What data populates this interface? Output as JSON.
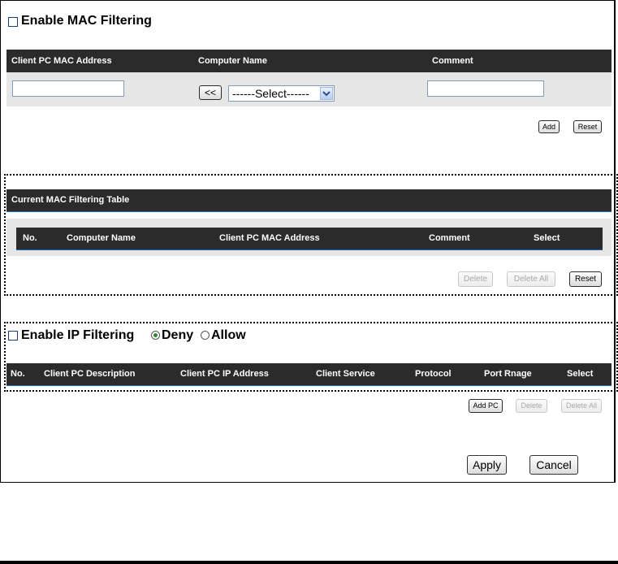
{
  "mac_filtering": {
    "enable_label": "Enable MAC Filtering",
    "enabled": false,
    "columns": [
      "Client PC MAC Address",
      "Computer Name",
      "Comment"
    ],
    "mac_input_value": "",
    "copy_button": "<<",
    "select_value": "------Select------",
    "comment_input_value": "",
    "add_button": "Add",
    "reset_button": "Reset"
  },
  "mac_table": {
    "title": "Current MAC Filtering Table",
    "columns": [
      "No.",
      "Computer Name",
      "Client PC MAC Address",
      "Comment",
      "Select"
    ],
    "delete_button": "Delete",
    "delete_all_button": "Delete All",
    "reset_button": "Reset"
  },
  "ip_filtering": {
    "enable_label": "Enable IP Filtering",
    "enabled": false,
    "deny_label": "Deny",
    "allow_label": "Allow",
    "mode": "Deny",
    "columns": [
      "No.",
      "Client PC Description",
      "Client PC IP Address",
      "Client Service",
      "Protocol",
      "Port Rnage",
      "Select"
    ],
    "add_pc_button": "Add PC",
    "delete_button": "Delete",
    "delete_all_button": "Delete All"
  },
  "footer": {
    "apply_button": "Apply",
    "cancel_button": "Cancel"
  },
  "colors": {
    "header_bar": "#2b2b2b",
    "row_background": "#e6e6e6",
    "accent_line": "#1e6fb5"
  }
}
